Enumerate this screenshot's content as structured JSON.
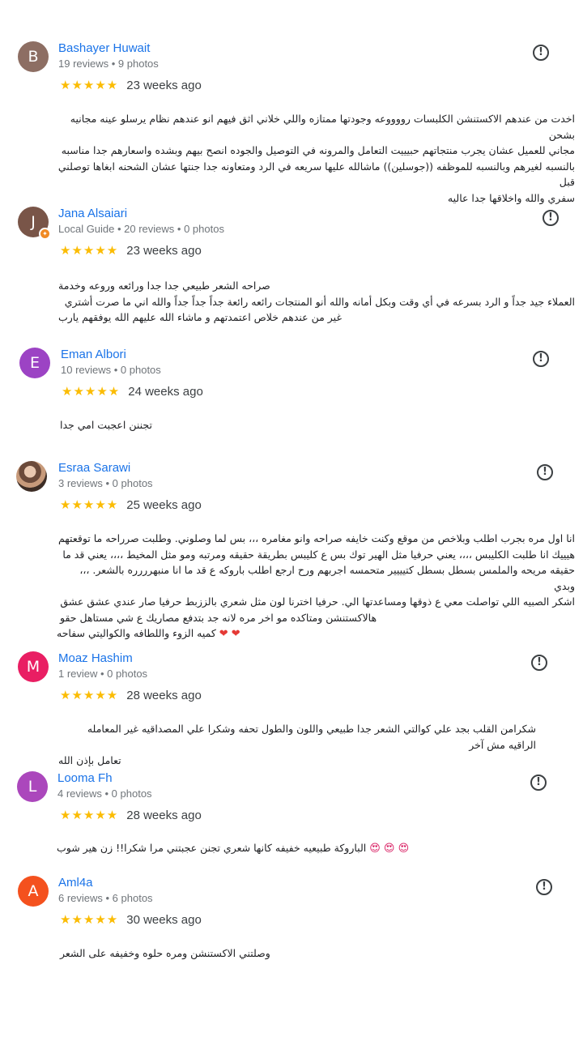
{
  "reviews": [
    {
      "avatar_letter": "B",
      "avatar_color": "#8d6e63",
      "name": "Bashayer Huwait",
      "meta": "19 reviews • 9 photos",
      "stars": "★★★★★",
      "time": "23 weeks ago",
      "lines": [
        "اخدت من عندهم الاكستنشن الكلبسات رووووعه وجودتها ممتازه واللي خلاني اثق فيهم انو عندهم نظام يرسلو عينه مجانيه بشحن",
        "مجاني للعميل عشان يجرب منتجاتهم حبيييت التعامل والمرونه في التوصيل والجوده انصح بيهم وبشده واسعارهم جدا مناسبه",
        "بالنسبه لغيرهم وبالنسبه للموظفه ((جوسلين)) ماشالله عليها سريعه في الرد ومتعاونه جدا جنتها عشان الشحنه ابغاها توصلني قبل",
        "سفري والله واخلاقها جدا عاليه"
      ]
    },
    {
      "avatar_letter": "J",
      "avatar_color": "#795548",
      "name": "Jana Alsaiari",
      "meta": "Local Guide • 20 reviews • 0 photos",
      "stars": "★★★★★",
      "time": "23 weeks ago",
      "lines": [
        "صراحه الشعر طبيعي جدا جدا ورائعه وروعه وخدمة",
        "العملاء جيد جداً و الرد بسرعه في أي وقت وبكل أمانه والله أنو المنتجات رائعه رائعة جداً جداً جداً والله اني ما صرت أشتري",
        "غير من عندهم خلاص اعتمدتهم و ماشاء الله عليهم الله يوفقهم يارب"
      ]
    },
    {
      "avatar_letter": "E",
      "avatar_color": "#9c43c4",
      "name": "Eman Albori",
      "meta": "10 reviews • 0 photos",
      "stars": "★★★★★",
      "time": "24 weeks ago",
      "lines": [
        "تجننن اعجبت امي جدا"
      ]
    },
    {
      "avatar_letter": "",
      "avatar_color": "#6b4a3a",
      "name": "Esraa Sarawi",
      "meta": "3 reviews • 0 photos",
      "stars": "★★★★★",
      "time": "25 weeks ago",
      "lines": [
        "انا اول مره بجرب اطلب وبلاخص من موقع وكنت خايفه صراحه وانو مغامره ،،، بس لما وصلوني. وطلبت صرراحه ما توقعتهم",
        "هيييك انا طلبت الكليبس ،،،، يعني حرفيا مثل الهير توك بس ع كليبس بطريقة حقيقه ومرتبه ومو مثل المخيط ،،،، يعني قد ما",
        "حقيقه مريحه والملمس بسطل بسطل كتيييير متحمسه اجربهم ورح ارجع اطلب باروكه ع قد ما انا منبهرررره بالشعر. ،،، وبدي",
        "اشكر الصبيه اللي تواصلت معي ع ذوقها ومساعدتها الي. حرفيا اخترنا لون مثل شعري بالززبط حرفيا صار عندي عشق عشق",
        "هالاكستنشن ومتاكده مو اخر مره لانه جد بتدفع مصاريك ع شي مستاهل حقو",
        "كميه الزوء واللطافه والكواليتي سفاحه"
      ],
      "emoji": "❤ ❤"
    },
    {
      "avatar_letter": "M",
      "avatar_color": "#e91e63",
      "name": "Moaz Hashim",
      "meta": "1 review • 0 photos",
      "stars": "★★★★★",
      "time": "28 weeks ago",
      "lines": [
        "شكرامن القلب بجد علي كوالتي الشعر جدا طبيعي واللون والطول تحفه وشكرا علي المصداقيه غير المعامله الراقيه مش آخر",
        "تعامل بإذن الله"
      ]
    },
    {
      "avatar_letter": "L",
      "avatar_color": "#ab47bc",
      "name": "Looma Fh",
      "meta": "4 reviews • 0 photos",
      "stars": "★★★★★",
      "time": "28 weeks ago",
      "lines": [
        "الباروكة طبيعيه خفيفه كانها شعري تجنن عجبتني مرا شكرا!! زن هير شوب"
      ],
      "emoji": "😍 😍 😍"
    },
    {
      "avatar_letter": "A",
      "avatar_color": "#f4511e",
      "name": "Aml4a",
      "meta": "6 reviews • 6 photos",
      "stars": "★★★★★",
      "time": "30 weeks ago",
      "lines": [
        "وصلتني الاكستنشن ومره حلوه وخفيفه على الشعر"
      ]
    }
  ]
}
